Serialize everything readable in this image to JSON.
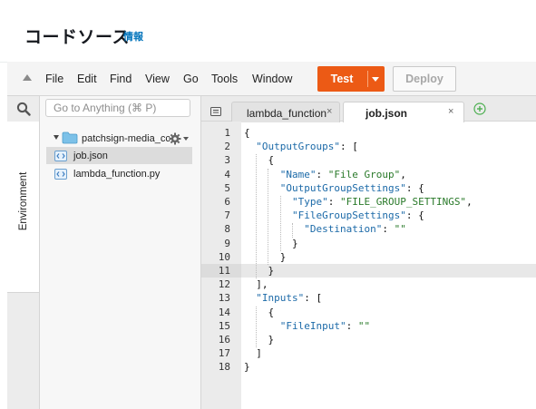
{
  "header": {
    "title": "コードソース",
    "info_link": "情報"
  },
  "menubar": {
    "items": [
      "File",
      "Edit",
      "Find",
      "View",
      "Go",
      "Tools",
      "Window"
    ],
    "test_label": "Test",
    "deploy_label": "Deploy"
  },
  "sidebar": {
    "search_placeholder": "Go to Anything (⌘ P)",
    "environment_tab": "Environment",
    "folder": "patchsign-media_cc",
    "files": [
      "job.json",
      "lambda_function.py"
    ],
    "selected_file": "job.json"
  },
  "editor": {
    "tabs": [
      {
        "label": "lambda_function",
        "close": "×",
        "active": false
      },
      {
        "label": "job.json",
        "close": "×",
        "active": true
      }
    ],
    "highlighted_line": 11,
    "lines": [
      {
        "num": "1",
        "text": "{"
      },
      {
        "num": "2",
        "text": "  \"OutputGroups\": ["
      },
      {
        "num": "3",
        "text": "    {"
      },
      {
        "num": "4",
        "text": "      \"Name\": \"File Group\","
      },
      {
        "num": "5",
        "text": "      \"OutputGroupSettings\": {"
      },
      {
        "num": "6",
        "text": "        \"Type\": \"FILE_GROUP_SETTINGS\","
      },
      {
        "num": "7",
        "text": "        \"FileGroupSettings\": {"
      },
      {
        "num": "8",
        "text": "          \"Destination\": \"\""
      },
      {
        "num": "9",
        "text": "        }"
      },
      {
        "num": "10",
        "text": "      }"
      },
      {
        "num": "11",
        "text": "    }"
      },
      {
        "num": "12",
        "text": "  ],"
      },
      {
        "num": "13",
        "text": "  \"Inputs\": ["
      },
      {
        "num": "14",
        "text": "    {"
      },
      {
        "num": "15",
        "text": "      \"FileInput\": \"\""
      },
      {
        "num": "16",
        "text": "    }"
      },
      {
        "num": "17",
        "text": "  ]"
      },
      {
        "num": "18",
        "text": "}"
      }
    ]
  },
  "colors": {
    "accent": "#ec5a15",
    "link": "#0073bb",
    "json_key": "#1c6aa8",
    "json_string": "#2a7a2a"
  }
}
